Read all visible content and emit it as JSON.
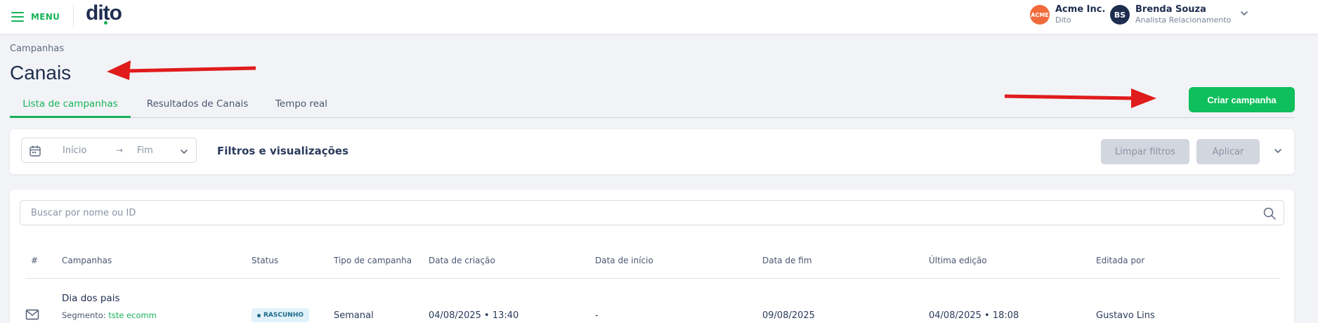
{
  "header": {
    "menu_label": "MENU",
    "logo_text": "dito",
    "company": {
      "logo_text": "ACME",
      "name": "Acme Inc.",
      "sub": "Dito"
    },
    "user": {
      "initials": "BS",
      "name": "Brenda Souza",
      "role": "Analista Relacionamento"
    }
  },
  "page": {
    "breadcrumb": "Campanhas",
    "title": "Canais",
    "create_button": "Criar campanha"
  },
  "tabs": [
    {
      "label": "Lista de campanhas",
      "active": true
    },
    {
      "label": "Resultados de Canais",
      "active": false
    },
    {
      "label": "Tempo real",
      "active": false
    }
  ],
  "filters": {
    "date_start": "Início",
    "date_arrow": "→",
    "date_end": "Fim",
    "title": "Filtros e visualizações",
    "clear_label": "Limpar filtros",
    "apply_label": "Aplicar"
  },
  "search": {
    "placeholder": "Buscar por nome ou ID"
  },
  "table": {
    "columns": [
      "#",
      "Campanhas",
      "Status",
      "Tipo de campanha",
      "Data de criação",
      "Data de início",
      "Data de fim",
      "Última edição",
      "Editada por"
    ],
    "rows": [
      {
        "icon": "mail-icon",
        "name": "Dia dos pais",
        "segment_label": "Segmento:",
        "segment_value": "tste ecomm",
        "status": "RASCUNHO",
        "type": "Semanal",
        "created": "04/08/2025 • 13:40",
        "start": "-",
        "end": "09/08/2025",
        "last_edit": "04/08/2025 • 18:08",
        "edited_by": "Gustavo Lins"
      }
    ]
  },
  "colors": {
    "brand_green": "#17b35a",
    "button_green": "#0fbf5c",
    "arrow_red": "#e01b1b",
    "text_dark": "#1f2d4f",
    "disabled_button": "#d2d6de",
    "badge_bg": "#e2f2fb"
  }
}
